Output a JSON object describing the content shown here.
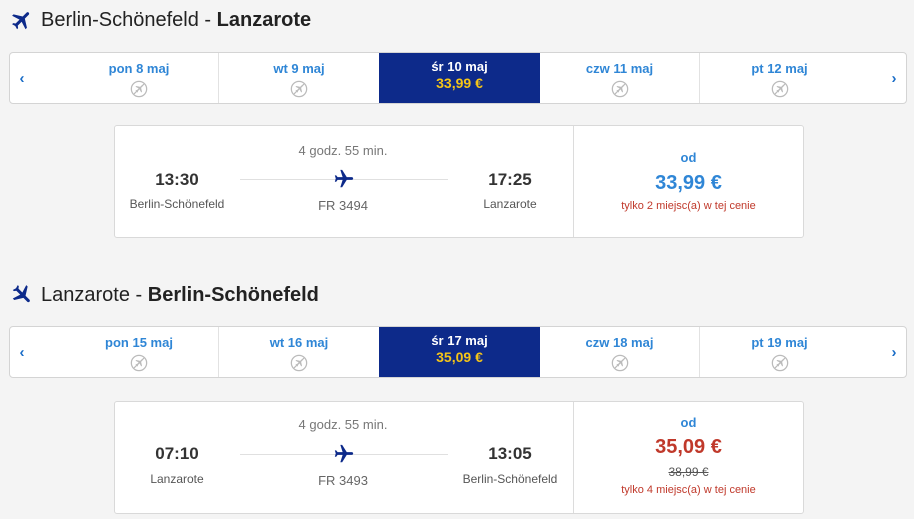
{
  "colors": {
    "accent": "#2f86d6",
    "selected_bg": "#0d2a8a",
    "selected_price": "#f5c518",
    "price_blue": "#2f86d6",
    "price_red": "#c0392b"
  },
  "outbound": {
    "origin": "Berlin-Schönefeld",
    "separator": " - ",
    "destination": "Lanzarote",
    "icon": "plane-icon",
    "nav_prev": "‹",
    "nav_next": "›",
    "dates": [
      {
        "label": "pon 8 maj",
        "price": "",
        "selected": false
      },
      {
        "label": "wt 9 maj",
        "price": "",
        "selected": false
      },
      {
        "label": "śr 10 maj",
        "price": "33,99 €",
        "selected": true
      },
      {
        "label": "czw 11 maj",
        "price": "",
        "selected": false
      },
      {
        "label": "pt 12 maj",
        "price": "",
        "selected": false
      }
    ],
    "flight": {
      "depart_time": "13:30",
      "depart_place": "Berlin-Schönefeld",
      "duration": "4 godz. 55 min.",
      "flight_no": "FR 3494",
      "arrive_time": "17:25",
      "arrive_place": "Lanzarote",
      "from_label": "od",
      "price": "33,99 €",
      "old_price": "",
      "seats_note": "tylko 2 miejsc(a) w tej cenie"
    }
  },
  "inbound": {
    "origin": "Lanzarote",
    "separator": " - ",
    "destination": "Berlin-Schönefeld",
    "icon": "plane-icon",
    "nav_prev": "‹",
    "nav_next": "›",
    "dates": [
      {
        "label": "pon 15 maj",
        "price": "",
        "selected": false
      },
      {
        "label": "wt 16 maj",
        "price": "",
        "selected": false
      },
      {
        "label": "śr 17 maj",
        "price": "35,09 €",
        "selected": true
      },
      {
        "label": "czw 18 maj",
        "price": "",
        "selected": false
      },
      {
        "label": "pt 19 maj",
        "price": "",
        "selected": false
      }
    ],
    "flight": {
      "depart_time": "07:10",
      "depart_place": "Lanzarote",
      "duration": "4 godz. 55 min.",
      "flight_no": "FR 3493",
      "arrive_time": "13:05",
      "arrive_place": "Berlin-Schönefeld",
      "from_label": "od",
      "price": "35,09 €",
      "old_price": "38,99 €",
      "seats_note": "tylko 4 miejsc(a) w tej cenie"
    }
  }
}
